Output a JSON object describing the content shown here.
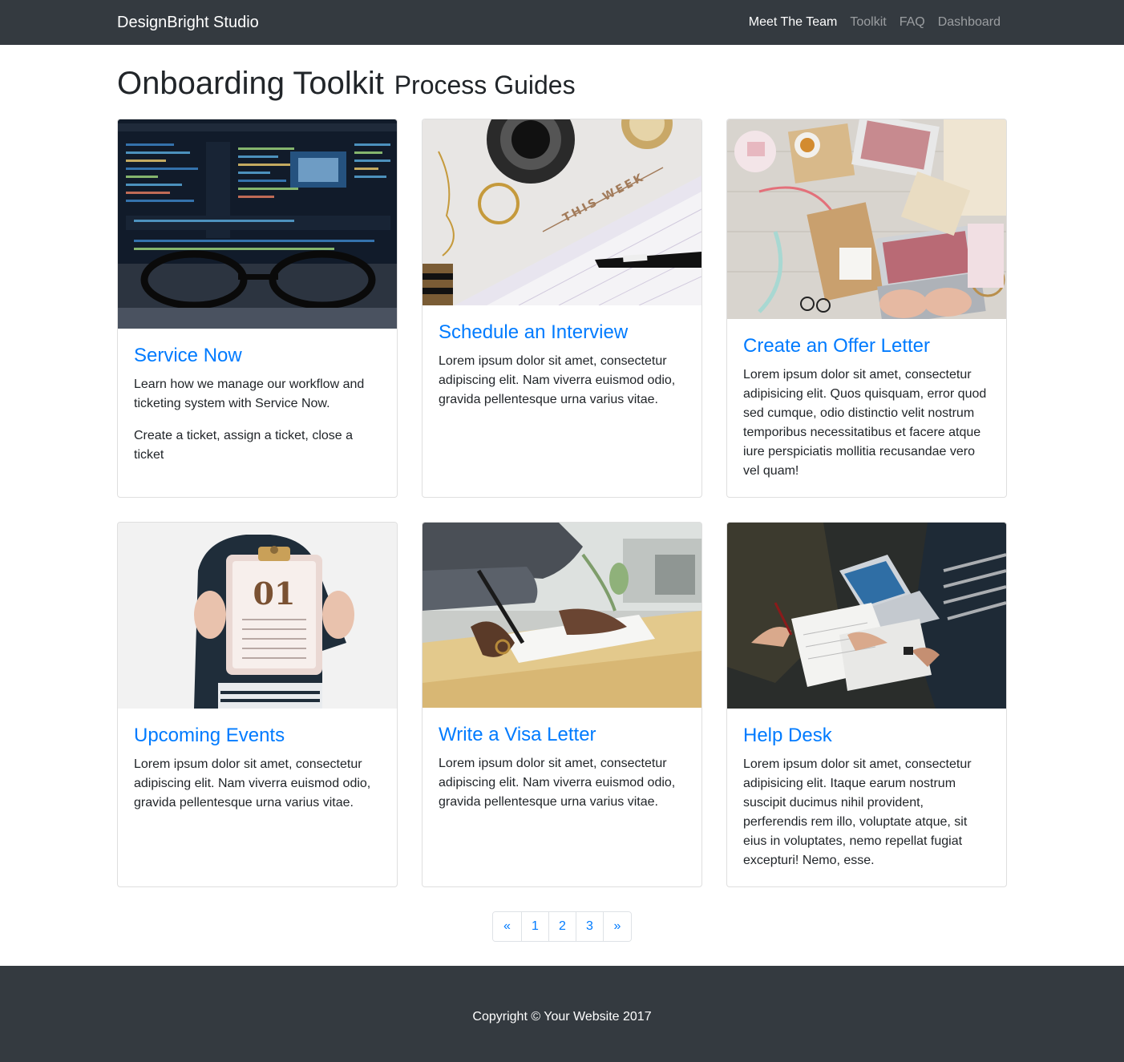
{
  "navbar": {
    "brand": "DesignBright Studio",
    "links": [
      {
        "label": "Meet The Team",
        "active": true
      },
      {
        "label": "Toolkit",
        "active": false
      },
      {
        "label": "FAQ",
        "active": false
      },
      {
        "label": "Dashboard",
        "active": false
      }
    ]
  },
  "heading": {
    "title": "Onboarding Toolkit",
    "subtitle": "Process Guides"
  },
  "cards": [
    {
      "title": "Service Now",
      "paragraphs": [
        "Learn how we manage our workflow and ticketing system with Service Now.",
        "Create a ticket, assign a ticket, close a ticket"
      ],
      "image": "code-monitor-with-glasses-photo"
    },
    {
      "title": "Schedule an Interview",
      "paragraphs": [
        "Lorem ipsum dolor sit amet, consectetur adipiscing elit. Nam viverra euismod odio, gravida pellentesque urna varius vitae."
      ],
      "image": "weekly-planner-with-camera-photo",
      "image_text": "THIS WEEK"
    },
    {
      "title": "Create an Offer Letter",
      "paragraphs": [
        "Lorem ipsum dolor sit amet, consectetur adipisicing elit. Quos quisquam, error quod sed cumque, odio distinctio velit nostrum temporibus necessitatibus et facere atque iure perspiciatis mollitia recusandae vero vel quam!"
      ],
      "image": "desk-flatlay-laptop-photo"
    },
    {
      "title": "Upcoming Events",
      "paragraphs": [
        "Lorem ipsum dolor sit amet, consectetur adipiscing elit. Nam viverra euismod odio, gravida pellentesque urna varius vitae."
      ],
      "image": "person-holding-calendar-photo",
      "image_text": "01"
    },
    {
      "title": "Write a Visa Letter",
      "paragraphs": [
        "Lorem ipsum dolor sit amet, consectetur adipiscing elit. Nam viverra euismod odio, gravida pellentesque urna varius vitae."
      ],
      "image": "signing-document-photo"
    },
    {
      "title": "Help Desk",
      "paragraphs": [
        "Lorem ipsum dolor sit amet, consectetur adipisicing elit. Itaque earum nostrum suscipit ducimus nihil provident, perferendis rem illo, voluptate atque, sit eius in voluptates, nemo repellat fugiat excepturi! Nemo, esse."
      ],
      "image": "team-meeting-papers-photo"
    }
  ],
  "pagination": {
    "prev": "«",
    "pages": [
      "1",
      "2",
      "3"
    ],
    "next": "»"
  },
  "footer": {
    "copyright": "Copyright © Your Website 2017"
  },
  "colors": {
    "navbar_bg": "#343a40",
    "link": "#007bff",
    "text": "#212529"
  }
}
